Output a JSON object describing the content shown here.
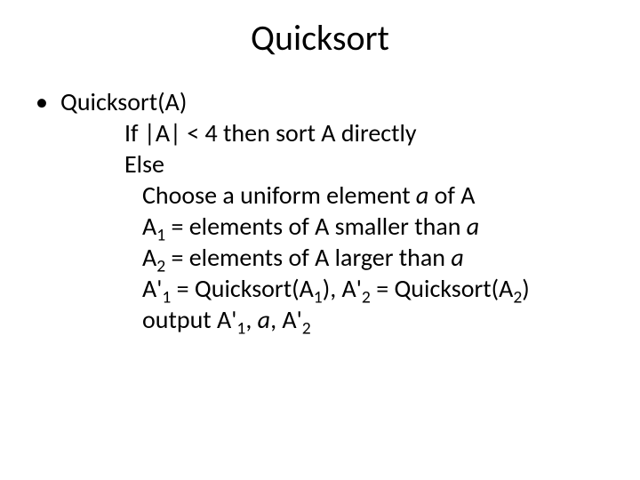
{
  "title": "Quicksort",
  "b0": "Quicksort(A)",
  "l1a": "If |A| < 4 then sort A directly",
  "l1b": "Else",
  "l2a_pre": "Choose a uniform element ",
  "l2a_a": "a",
  "l2a_post": " of A",
  "l2b_A": "A",
  "l2b_s1": "1",
  "l2b_mid": " = elements of A smaller than ",
  "l2b_a": "a",
  "l2c_A": "A",
  "l2c_s2": "2",
  "l2c_mid": " = elements of A larger than ",
  "l2c_a": "a",
  "l2d_A1p": "A'",
  "l2d_s1": "1",
  "l2d_eq1": " = Quicksort(A",
  "l2d_s1b": "1",
  "l2d_close1": "), ",
  "l2d_A2p": "A'",
  "l2d_s2": "2",
  "l2d_eq2": " = Quicksort(A",
  "l2d_s2b": "2",
  "l2d_close2": ")",
  "l2e_out": "output ",
  "l2e_A1p": "A'",
  "l2e_s1": "1",
  "l2e_c1": ", ",
  "l2e_a": "a",
  "l2e_c2": ", ",
  "l2e_A2p": "A'",
  "l2e_s2": "2"
}
